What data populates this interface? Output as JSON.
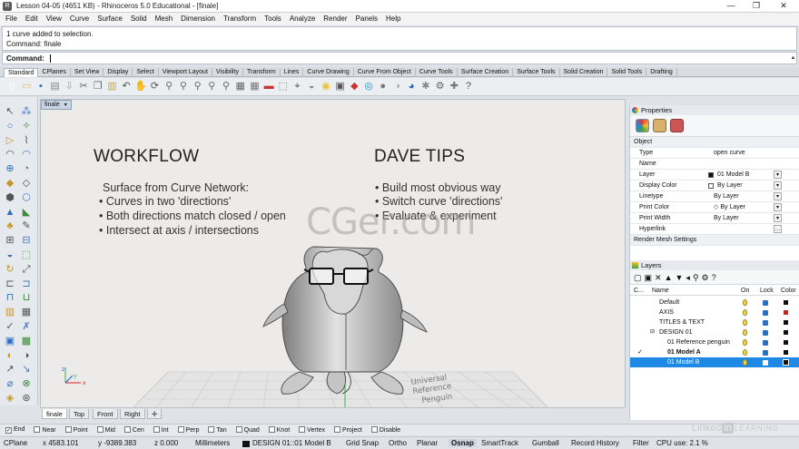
{
  "window": {
    "title": "Lesson 04-05 (4651 KB) - Rhinoceros 5.0 Educational - [finale]",
    "minimize": "—",
    "restore": "❐",
    "close": "✕"
  },
  "menu": [
    "File",
    "Edit",
    "View",
    "Curve",
    "Surface",
    "Solid",
    "Mesh",
    "Dimension",
    "Transform",
    "Tools",
    "Analyze",
    "Render",
    "Panels",
    "Help"
  ],
  "command_history": [
    "1 curve added to selection.",
    "Command: finale"
  ],
  "command_prompt": {
    "label": "Command:",
    "value": ""
  },
  "toolbar_tabs": [
    "Standard",
    "CPlanes",
    "Set View",
    "Display",
    "Select",
    "Viewport Layout",
    "Visibility",
    "Transform",
    "Lines",
    "Curve Drawing",
    "Curve From Object",
    "Curve Tools",
    "Surface Creation",
    "Surface Tools",
    "Solid Creation",
    "Solid Tools",
    "Drafting"
  ],
  "viewport": {
    "name": "finale",
    "slide": {
      "left_title": "WORKFLOW",
      "left_lines": [
        "Surface from Curve Network:",
        "• Curves in two 'directions'",
        "• Both directions match closed / open",
        "• Intersect at axis / intersections"
      ],
      "right_title": "DAVE TIPS",
      "right_lines": [
        "• Build most obvious way",
        "• Switch curve 'directions'",
        "• Evaluate & experiment"
      ]
    },
    "watermark": "CGer.com",
    "floor_text": [
      "Universal",
      "Reference",
      "Penguin"
    ],
    "axis_labels": {
      "x": "x",
      "y": "y",
      "z": "z"
    }
  },
  "viewport_tabs": [
    "finale",
    "Top",
    "Front",
    "Right",
    "✛"
  ],
  "properties": {
    "title": "Properties",
    "section": "Object",
    "rows": [
      {
        "k": "Type",
        "v": "open curve",
        "dd": ""
      },
      {
        "k": "Name",
        "v": "",
        "dd": ""
      },
      {
        "k": "Layer",
        "v": "01 Model B",
        "dd": "▾"
      },
      {
        "k": "Display Color",
        "v": "By Layer",
        "dd": "▾"
      },
      {
        "k": "Linetype",
        "v": "By Layer",
        "dd": "▾"
      },
      {
        "k": "Print Color",
        "v": "◇ By Layer",
        "dd": "▾"
      },
      {
        "k": "Print Width",
        "v": "By Layer",
        "dd": "▾"
      },
      {
        "k": "Hyperlink",
        "v": "",
        "dd": "…"
      }
    ],
    "footer": "Render Mesh Settings"
  },
  "layers": {
    "title": "Layers",
    "headers": [
      "C...",
      "Name",
      "On",
      "Lock",
      "Color"
    ],
    "rows": [
      {
        "check": "",
        "name": "Default",
        "indent": 0,
        "color": "#111111",
        "selected": false,
        "bold": false
      },
      {
        "check": "",
        "name": "AXIS",
        "indent": 0,
        "color": "#d81e1e",
        "selected": false,
        "bold": false
      },
      {
        "check": "",
        "name": "TITLES & TEXT",
        "indent": 0,
        "color": "#111111",
        "selected": false,
        "bold": false
      },
      {
        "check": "",
        "name": "DESIGN 01",
        "indent": 0,
        "color": "#111111",
        "selected": false,
        "bold": false,
        "expander": "⊟"
      },
      {
        "check": "",
        "name": "01 Reference penguin",
        "indent": 1,
        "color": "#111111",
        "selected": false,
        "bold": false
      },
      {
        "check": "✓",
        "name": "01 Model A",
        "indent": 1,
        "color": "#111111",
        "selected": false,
        "bold": true
      },
      {
        "check": "",
        "name": "01 Model B",
        "indent": 1,
        "color": "#111111",
        "selected": true,
        "bold": false
      }
    ]
  },
  "osnap": [
    {
      "label": "End",
      "checked": true
    },
    {
      "label": "Near",
      "checked": false
    },
    {
      "label": "Point",
      "checked": false
    },
    {
      "label": "Mid",
      "checked": false
    },
    {
      "label": "Cen",
      "checked": false
    },
    {
      "label": "Int",
      "checked": false
    },
    {
      "label": "Perp",
      "checked": false
    },
    {
      "label": "Tan",
      "checked": false
    },
    {
      "label": "Quad",
      "checked": false
    },
    {
      "label": "Knot",
      "checked": false
    },
    {
      "label": "Vertex",
      "checked": false
    },
    {
      "label": "Project",
      "checked": false
    },
    {
      "label": "Disable",
      "checked": false
    }
  ],
  "status": {
    "cplane": "CPlane",
    "x": "x 4583.101",
    "y": "y -9389.383",
    "z": "z 0.000",
    "units": "Millimeters",
    "layer": "DESIGN 01::01 Model B",
    "toggles": [
      "Grid Snap",
      "Ortho",
      "Planar",
      "Osnap",
      "SmartTrack",
      "Gumball",
      "Record History",
      "Filter"
    ],
    "cpu": "CPU use: 2.1 %"
  },
  "branding": {
    "left": "Linked",
    "box": "in",
    "right": "LEARNING"
  },
  "colors": {
    "accent": "#1a73c9",
    "selected_row": "#1e88e5",
    "viewport_bg": "#ecebea"
  }
}
